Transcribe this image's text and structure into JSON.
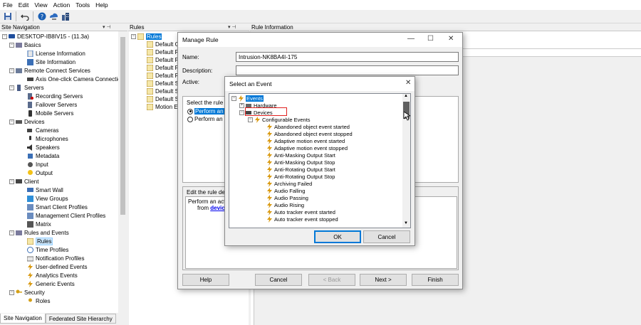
{
  "menu": [
    "File",
    "Edit",
    "View",
    "Action",
    "Tools",
    "Help"
  ],
  "panels": {
    "site_navigation": "Site Navigation",
    "rules": "Rules",
    "rule_information": "Rule Information"
  },
  "nav_tree": {
    "root": "DESKTOP-IB8IV15 - (11.3a)",
    "basics": "Basics",
    "license_information": "License Information",
    "site_information": "Site Information",
    "remote_connect_services": "Remote Connect Services",
    "axis_one_click": "Axis One-click Camera Connectio",
    "servers": "Servers",
    "recording_servers": "Recording Servers",
    "failover_servers": "Failover Servers",
    "mobile_servers": "Mobile Servers",
    "devices": "Devices",
    "cameras": "Cameras",
    "microphones": "Microphones",
    "speakers": "Speakers",
    "metadata": "Metadata",
    "input": "Input",
    "output": "Output",
    "client": "Client",
    "smart_wall": "Smart Wall",
    "view_groups": "View Groups",
    "smart_client_profiles": "Smart Client Profiles",
    "management_client_profiles": "Management Client Profiles",
    "matrix": "Matrix",
    "rules_and_events": "Rules and Events",
    "rules": "Rules",
    "time_profiles": "Time Profiles",
    "notification_profiles": "Notification Profiles",
    "user_defined_events": "User-defined Events",
    "analytics_events": "Analytics Events",
    "generic_events": "Generic Events",
    "security": "Security",
    "roles": "Roles"
  },
  "bottom_tabs": [
    "Site Navigation",
    "Federated Site Hierarchy"
  ],
  "rules_tree": {
    "root": "Rules",
    "items": [
      "Default G",
      "Default P",
      "Default R",
      "Default R",
      "Default R",
      "Default S",
      "Default S",
      "Default S",
      "Motion El"
    ]
  },
  "manage_rule": {
    "title": "Manage Rule",
    "name_label": "Name:",
    "name_value": "Intrusion-NK8BA4I-175",
    "description_label": "Description:",
    "active_label": "Active:",
    "select_rule_type": "Select the rule ty",
    "option1": "Perform an a",
    "option2": "Perform an a",
    "edit_desc_label": "Edit the rule des",
    "desc_line1": "Perform an actio",
    "desc_line2_prefix": "from",
    "desc_link": "device",
    "help": "Help",
    "cancel": "Cancel",
    "back": "< Back",
    "next": "Next >",
    "finish": "Finish"
  },
  "select_event": {
    "title": "Select an Event",
    "events": "Events",
    "hardware": "Hardware",
    "devices": "Devices",
    "configurable_events": "Configurable Events",
    "items": [
      "Abandoned object event started",
      "Abandoned object event stopped",
      "Adaptive motion event started",
      "Adaptive motion event stopped",
      "Anti-Masking Output Start",
      "Anti-Masking Output Stop",
      "Anti-Rotating Output Start",
      "Anti-Rotating Output Stop",
      "Archiving Failed",
      "Audio Falling",
      "Audio Passing",
      "Audio Rising",
      "Auto tracker event started",
      "Auto tracker event stopped"
    ],
    "ok": "OK",
    "cancel": "Cancel"
  },
  "colors": {
    "selection": "#0078d7",
    "highlight_box": "#e0201e",
    "link": "#0000ee"
  }
}
